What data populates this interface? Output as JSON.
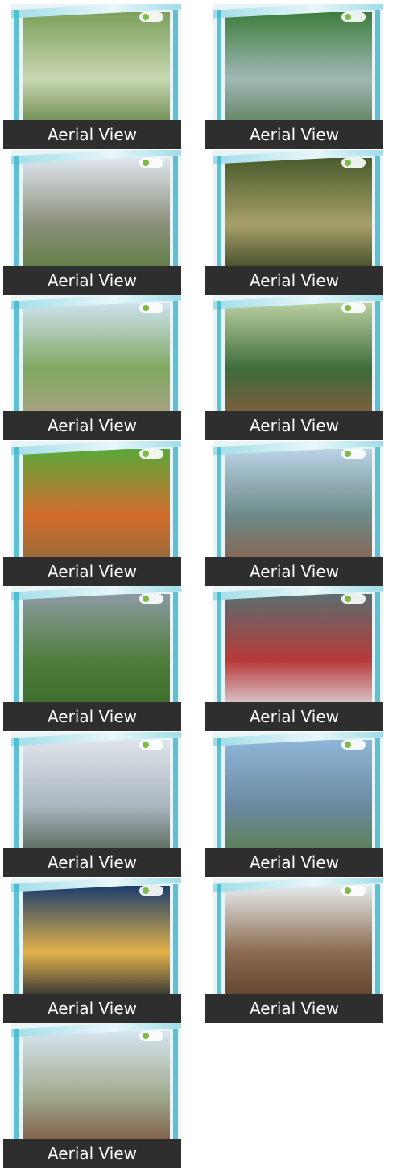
{
  "gallery": {
    "items": [
      {
        "caption": "Aerial View",
        "scene": "family-garden",
        "colors": [
          "#7ba05b",
          "#c9d7b2",
          "#5d7d3e"
        ]
      },
      {
        "caption": "Aerial View",
        "scene": "highway-interchange",
        "colors": [
          "#3e7d3c",
          "#9fb8b5",
          "#567a52"
        ]
      },
      {
        "caption": "Aerial View",
        "scene": "rock-cliff",
        "colors": [
          "#dfe6ee",
          "#8a8f7a",
          "#5a7b3a"
        ]
      },
      {
        "caption": "Aerial View",
        "scene": "forest-sunset",
        "colors": [
          "#4a5b2c",
          "#a8a06a",
          "#2f3d1a"
        ]
      },
      {
        "caption": "Aerial View",
        "scene": "country-road",
        "colors": [
          "#cde2ef",
          "#7fa85f",
          "#b0a08a"
        ]
      },
      {
        "caption": "Aerial View",
        "scene": "farmers-field",
        "colors": [
          "#b9cfa0",
          "#3e6b3a",
          "#8b5c3d"
        ]
      },
      {
        "caption": "Aerial View",
        "scene": "vegetable-crate",
        "colors": [
          "#59a83a",
          "#d46c2b",
          "#8a6b3d"
        ]
      },
      {
        "caption": "Aerial View",
        "scene": "open-land-hills",
        "colors": [
          "#b9d3e6",
          "#6d8a88",
          "#8b5f48"
        ]
      },
      {
        "caption": "Aerial View",
        "scene": "green-hills",
        "colors": [
          "#8c9aa3",
          "#4f7d3a",
          "#3a6a2c"
        ]
      },
      {
        "caption": "Aerial View",
        "scene": "sold-out-cake",
        "colors": [
          "#5b6d6e",
          "#b83a3a",
          "#e2e8ee"
        ]
      },
      {
        "caption": "Aerial View",
        "scene": "cloudy-mountains",
        "colors": [
          "#dfe4ea",
          "#aab5bf",
          "#4b5a48"
        ]
      },
      {
        "caption": "Aerial View",
        "scene": "blue-sky-land",
        "colors": [
          "#8fb6d8",
          "#6a8aa0",
          "#5b7d45"
        ]
      },
      {
        "caption": "Aerial View",
        "scene": "night-bridge",
        "colors": [
          "#1c3d6b",
          "#e3b24a",
          "#0d1a33"
        ]
      },
      {
        "caption": "Aerial View",
        "scene": "tree-excavator",
        "colors": [
          "#e6eaec",
          "#8a6b4e",
          "#5a3d2b"
        ]
      },
      {
        "caption": "Aerial View",
        "scene": "fenced-plot",
        "colors": [
          "#d7e5ef",
          "#9fa88c",
          "#7a4e3a"
        ]
      }
    ]
  }
}
